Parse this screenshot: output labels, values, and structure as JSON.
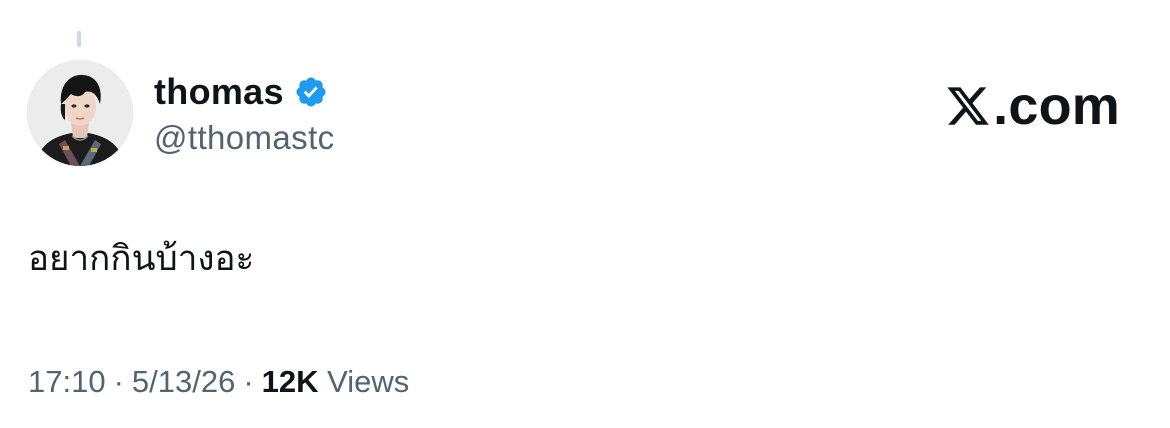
{
  "header": {
    "display_name": "thomas",
    "handle": "@tthomastc",
    "verified": true,
    "verified_color": "#1d9bf0",
    "verified_icon": "verified-badge-icon",
    "avatar_icon": "profile-photo-icon"
  },
  "brand": {
    "logo_icon": "x-logo-icon",
    "domain": ".com"
  },
  "tweet": {
    "text": "อยากกินบ้างอะ"
  },
  "meta": {
    "time": "17:10",
    "separator": "·",
    "date": "5/13/26",
    "views_count": "12K",
    "views_label": "Views"
  },
  "colors": {
    "text_primary": "#0f1419",
    "text_secondary": "#536471",
    "background": "#ffffff"
  }
}
